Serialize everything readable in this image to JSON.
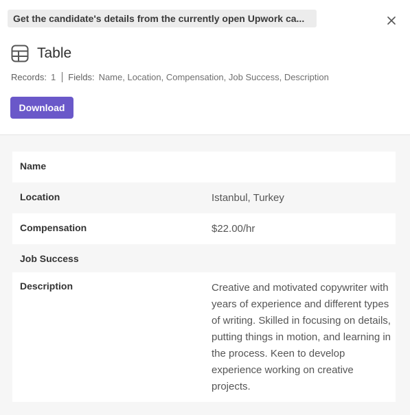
{
  "query": "Get the candidate's details from the currently open Upwork ca...",
  "header": {
    "title": "Table",
    "records_label": "Records:",
    "records_value": "1",
    "fields_label": "Fields:",
    "fields_value": "Name, Location, Compensation, Job Success, Description",
    "download_label": "Download"
  },
  "icons": {
    "close": "close-icon",
    "table": "table-icon"
  },
  "colors": {
    "accent": "#6a58c9",
    "surface": "#f6f6f6"
  },
  "record": {
    "name_label": "Name",
    "name_value": "",
    "location_label": "Location",
    "location_value": "Istanbul, Turkey",
    "compensation_label": "Compensation",
    "compensation_value": "$22.00/hr",
    "job_success_label": "Job Success",
    "job_success_value": "",
    "description_label": "Description",
    "description_value": "Creative and motivated copywriter with years of experience and different types of writing. Skilled in focusing on details, putting things in motion, and learning in the process. Keen to develop experience working on creative projects."
  }
}
